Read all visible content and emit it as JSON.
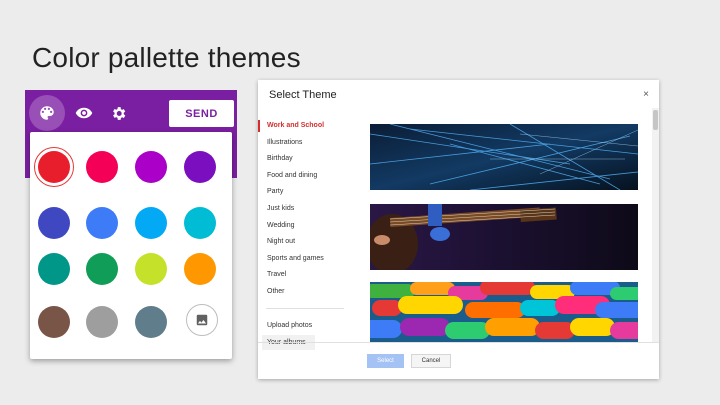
{
  "slide": {
    "title": "Color pallette themes"
  },
  "toolbar": {
    "send_label": "SEND",
    "accent": "#7b1fa2",
    "icons": [
      "palette-icon",
      "eye-icon",
      "gear-icon"
    ]
  },
  "palette": {
    "colors": [
      "#e91e2d",
      "#f50057",
      "#aa00c7",
      "#7b0fbf",
      "#3f48c1",
      "#3d7cf6",
      "#03a9f4",
      "#00bcd4",
      "#009688",
      "#0f9d58",
      "#c6e12a",
      "#ff9800",
      "#795548",
      "#9e9e9e",
      "#607d8b"
    ],
    "selected_index": 0,
    "image_icon": "image-icon"
  },
  "dialog": {
    "title": "Select Theme",
    "close": "×",
    "categories": [
      "Work and School",
      "Illustrations",
      "Birthday",
      "Food and dining",
      "Party",
      "Just kids",
      "Wedding",
      "Night out",
      "Sports and games",
      "Travel",
      "Other"
    ],
    "active_category": "Work and School",
    "upload_label": "Upload photos",
    "albums_label": "Your albums",
    "thumbnails": [
      "abstract-light-streaks-image",
      "guitar-player-image",
      "colorful-candy-image"
    ],
    "select_label": "Select",
    "cancel_label": "Cancel"
  }
}
